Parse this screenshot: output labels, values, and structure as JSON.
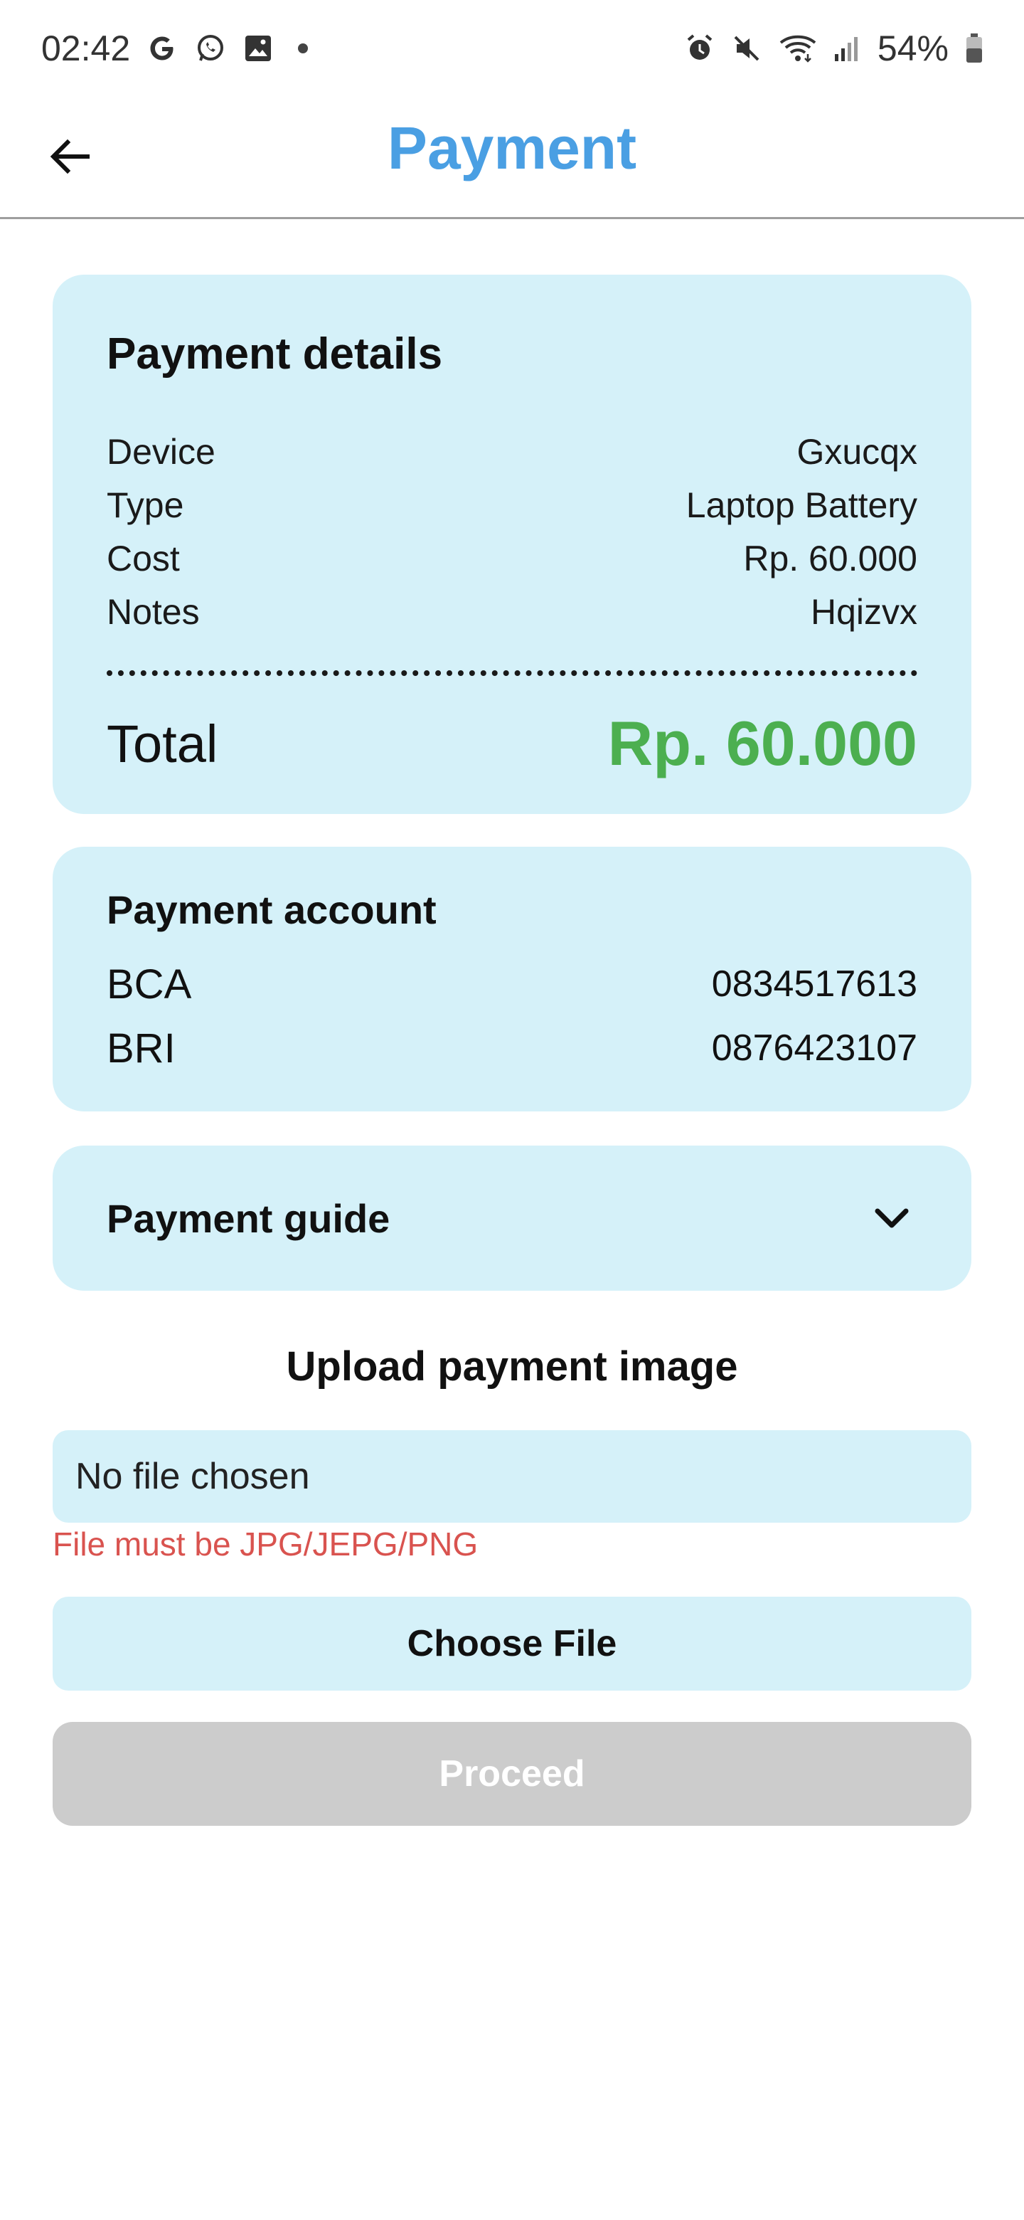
{
  "status_bar": {
    "time": "02:42",
    "battery": "54%",
    "left_icons": [
      "google-icon",
      "whatsapp-icon",
      "gallery-icon",
      "notification-dot"
    ],
    "right_icons": [
      "alarm-icon",
      "mute-icon",
      "wifi-icon",
      "signal-icon",
      "battery-icon"
    ]
  },
  "header": {
    "title": "Payment",
    "back_icon": "arrow-left-icon"
  },
  "payment_details": {
    "title": "Payment details",
    "rows": [
      {
        "label": "Device",
        "value": "Gxucqx"
      },
      {
        "label": "Type",
        "value": "Laptop Battery"
      },
      {
        "label": "Cost",
        "value": "Rp. 60.000"
      },
      {
        "label": "Notes",
        "value": "Hqizvx"
      }
    ],
    "total_label": "Total",
    "total_value": "Rp. 60.000"
  },
  "payment_account": {
    "title": "Payment account",
    "accounts": [
      {
        "bank": "BCA",
        "number": "0834517613"
      },
      {
        "bank": "BRI",
        "number": "0876423107"
      }
    ]
  },
  "payment_guide": {
    "title": "Payment guide",
    "icon": "chevron-down-icon"
  },
  "upload": {
    "heading": "Upload payment image",
    "file_status": "No file chosen",
    "error": "File must be JPG/JEPG/PNG",
    "choose_label": "Choose File",
    "proceed_label": "Proceed"
  },
  "colors": {
    "accent": "#4a9fe3",
    "card_bg": "#d5f1f9",
    "total_green": "#4caf50",
    "error_red": "#d9534f",
    "disabled_gray": "#cccccc"
  }
}
